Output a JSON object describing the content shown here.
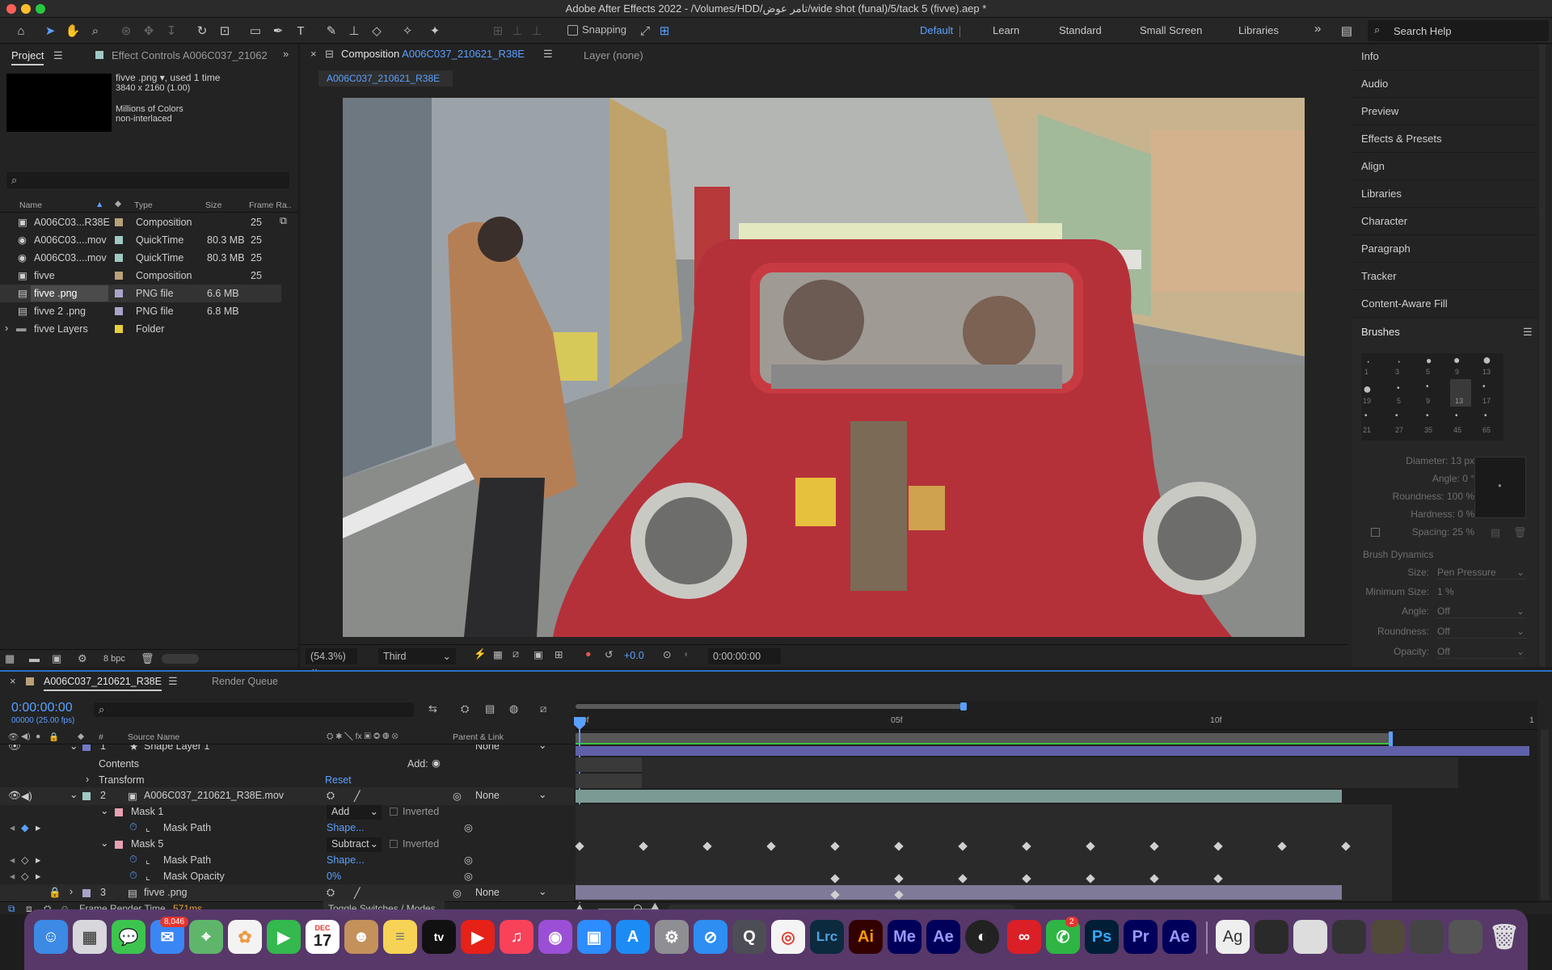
{
  "window": {
    "title": "Adobe After Effects 2022 - /Volumes/HDD/تامر عوض/wide shot (funal)/5/tack 5 (fivve).aep *"
  },
  "toolbar": {
    "snapping_label": "Snapping",
    "workspaces": [
      "Default",
      "Learn",
      "Standard",
      "Small Screen",
      "Libraries"
    ],
    "search_placeholder": "Search Help"
  },
  "project_panel": {
    "tab_project": "Project",
    "tab_effect_controls": "Effect Controls A006C037_21062",
    "selected_name": "fivve .png",
    "selected_usage": ", used 1 time",
    "selected_dims": "3840 x 2160 (1.00)",
    "selected_colors": "Millions of Colors",
    "selected_interlace": "non-interlaced",
    "columns": {
      "name": "Name",
      "type": "Type",
      "size": "Size",
      "frame_rate": "Frame Ra.."
    },
    "items": [
      {
        "name": "A006C03...R38E",
        "type": "Composition",
        "size": "",
        "fps": "25",
        "color": "#b8a17a"
      },
      {
        "name": "A006C03....mov",
        "type": "QuickTime",
        "size": "80.3 MB",
        "fps": "25",
        "color": "#9fc9c2"
      },
      {
        "name": "A006C03....mov",
        "type": "QuickTime",
        "size": "80.3 MB",
        "fps": "25",
        "color": "#9fc9c2"
      },
      {
        "name": "fivve",
        "type": "Composition",
        "size": "",
        "fps": "25",
        "color": "#b8a17a"
      },
      {
        "name": "fivve .png",
        "type": "PNG file",
        "size": "6.6 MB",
        "fps": "",
        "color": "#a9a3c9"
      },
      {
        "name": "fivve 2 .png",
        "type": "PNG file",
        "size": "6.8 MB",
        "fps": "",
        "color": "#a9a3c9"
      },
      {
        "name": "fivve Layers",
        "type": "Folder",
        "size": "",
        "fps": "",
        "color": "#e6cf3c"
      }
    ],
    "bpc": "8 bpc"
  },
  "composition_panel": {
    "tab_prefix": "Composition",
    "tab_name": "A006C037_210621_R38E",
    "layer_tab": "Layer (none)",
    "subtab": "A006C037_210621_R38E",
    "zoom": "(54.3%)",
    "resolution": "Third",
    "exposure": "+0.0",
    "timecode": "0:00:00:00"
  },
  "right_panel": {
    "items": [
      "Info",
      "Audio",
      "Preview",
      "Effects & Presets",
      "Align",
      "Libraries",
      "Character",
      "Paragraph",
      "Tracker",
      "Content-Aware Fill"
    ],
    "brushes_title": "Brushes",
    "brush_sizes": [
      "1",
      "3",
      "5",
      "9",
      "13",
      "19",
      "5",
      "9",
      "13",
      "17",
      "21",
      "27",
      "35",
      "45",
      "65"
    ],
    "diameter": "Diameter: 13 px",
    "angle": "Angle: 0 °",
    "roundness": "Roundness: 100 %",
    "hardness": "Hardness: 0 %",
    "spacing": "Spacing:  25 %",
    "dynamics_title": "Brush Dynamics",
    "dyn_size_label": "Size:",
    "dyn_size_value": "Pen Pressure",
    "dyn_min_label": "Minimum Size:",
    "dyn_min_value": "1 %",
    "dyn_angle_label": "Angle:",
    "dyn_angle_value": "Off",
    "dyn_round_label": "Roundness:",
    "dyn_round_value": "Off",
    "dyn_opacity_label": "Opacity:",
    "dyn_opacity_value": "Off"
  },
  "timeline": {
    "tab_comp": "A006C037_210621_R38E",
    "tab_render": "Render Queue",
    "timecode": "0:00:00:00",
    "frames": "00000 (25.00 fps)",
    "col_source": "Source Name",
    "col_parent": "Parent & Link",
    "ruler_labels": [
      "00f",
      "05f",
      "10f",
      "1"
    ],
    "rows": [
      {
        "num": "1",
        "name": "Shape Layer 1",
        "parent": "None"
      },
      {
        "label": "Contents",
        "add": "Add:"
      },
      {
        "label": "Transform",
        "value": "Reset"
      },
      {
        "num": "2",
        "name": "A006C037_210621_R38E.mov",
        "parent": "None"
      },
      {
        "label": "Mask 1",
        "mode": "Add",
        "inverted": "Inverted"
      },
      {
        "label": "Mask Path",
        "value": "Shape..."
      },
      {
        "label": "Mask 5",
        "mode": "Subtract",
        "inverted": "Inverted"
      },
      {
        "label": "Mask Path",
        "value": "Shape..."
      },
      {
        "label": "Mask Opacity",
        "value": "0%"
      },
      {
        "num": "3",
        "name": "fivve .png",
        "parent": "None"
      }
    ],
    "render_time_label": "Frame Render Time",
    "render_time_value": "571ms",
    "toggle_label": "Toggle Switches / Modes"
  },
  "dock": {
    "mail_badge": "8,046",
    "calendar_month": "DEC",
    "calendar_day": "17",
    "whatsapp_badge": "2",
    "apps": [
      "Finder",
      "Launchpad",
      "Messages",
      "Mail",
      "Maps",
      "Photos",
      "FaceTime",
      "Calendar",
      "Contacts",
      "Notes",
      "TV",
      "YouTube",
      "Music",
      "Podcasts",
      "Zoom",
      "App Store",
      "System Preferences",
      "Safari",
      "QuickTime",
      "Chrome",
      "Lightroom Classic",
      "Illustrator",
      "Media Encoder",
      "After Effects",
      "Cinema 4D",
      "Creative Cloud",
      "WhatsApp",
      "Photoshop",
      "Premiere Pro",
      "After Effects",
      "Font Book"
    ]
  }
}
